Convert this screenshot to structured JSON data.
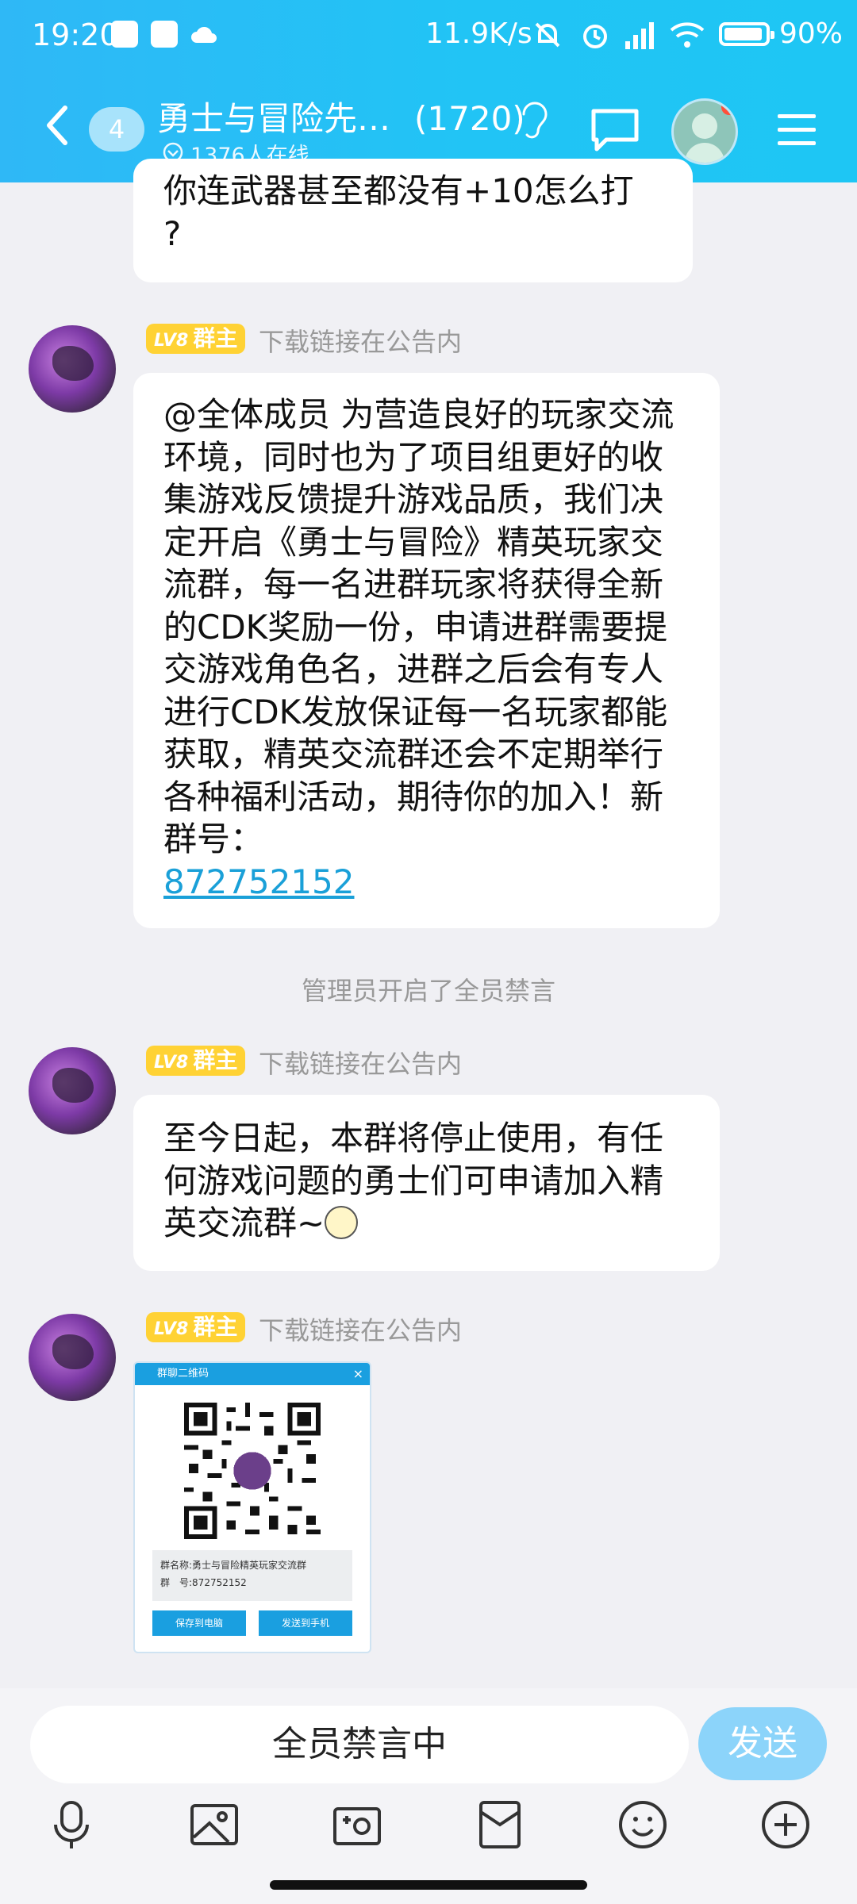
{
  "status_bar": {
    "time": "19:20",
    "network_speed": "11.9K/s",
    "battery": "90%",
    "battery_level": 0.9
  },
  "header": {
    "unread_count": "4",
    "group_name": "勇士与冒险先…",
    "member_count": "(1720)",
    "online_text": "1376人在线",
    "icons": [
      "back-icon",
      "ear-icon",
      "chat-icon",
      "avatar",
      "menu-icon"
    ]
  },
  "messages": {
    "partial_text": "你连武器甚至都没有+10怎么打\n?",
    "sender_level": "LV8",
    "sender_role": "群主",
    "sender_nick": "下载链接在公告内",
    "announcement_text": "@全体成员 为营造良好的玩家交流环境，同时也为了项目组更好的收集游戏反馈提升游戏品质，我们决定开启《勇士与冒险》精英玩家交流群，每一名进群玩家将获得全新的CDK奖励一份，申请进群需要提交游戏角色名，进群之后会有专人进行CDK发放保证每一名玩家都能获取，精英交流群还会不定期举行各种福利活动，期待你的加入！新群号：",
    "group_number": "872752152",
    "system_notice": "管理员开启了全员禁言",
    "stop_text": "至今日起，本群将停止使用，有任何游戏问题的勇士们可申请加入精英交流群~",
    "qr_card": {
      "title": "群聊二维码",
      "close": "×",
      "name_line": "群名称:勇士与冒险精英玩家交流群",
      "number_line": "群　号:872752152",
      "save_button": "保存到电脑",
      "send_button": "发送到手机"
    }
  },
  "input_bar": {
    "placeholder": "全员禁言中",
    "send_label": "发送",
    "tools": [
      "mic-icon",
      "image-icon",
      "camera-icon",
      "red-packet-icon",
      "emoji-icon",
      "plus-icon"
    ]
  },
  "colors": {
    "header_start": "#2fb8f6",
    "header_end": "#1ec6f4",
    "link": "#1aa0d8",
    "badge_gold": "#ffd234",
    "send_button": "#8cd4fa"
  }
}
